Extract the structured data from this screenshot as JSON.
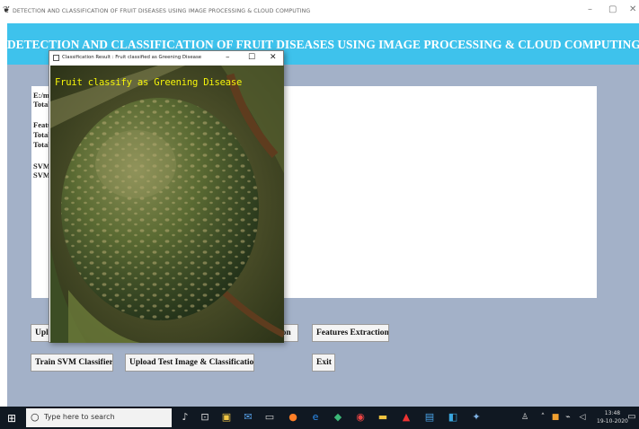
{
  "window": {
    "title": "DETECTION AND CLASSIFICATION OF FRUIT DISEASES USING IMAGE PROCESSING & CLOUD COMPUTING",
    "minimize": "–",
    "restore": "▢",
    "close": "✕"
  },
  "app": {
    "heading": "DETECTION AND CLASSIFICATION OF FRUIT DISEASES USING IMAGE PROCESSING & CLOUD COMPUTING",
    "output_lines": [
      "E:/m",
      "Total",
      "Featu",
      "Total",
      "Total",
      "SVM",
      "SVM"
    ],
    "buttons": {
      "upload": "Upl",
      "preprocess_suffix": "ion",
      "features": "Features Extraction",
      "train": "Train SVM Classifier",
      "upload_test": "Upload Test Image & Classification",
      "exit": "Exit"
    }
  },
  "popup": {
    "title": "Classification Result : Fruit classified as Greening Disease",
    "minimize": "–",
    "restore": "☐",
    "close": "✕",
    "overlay_text": "Fruit classify as Greening Disease"
  },
  "taskbar": {
    "search_placeholder": "Type here to search",
    "time": "13:48",
    "date": "19-10-2020"
  },
  "colors": {
    "header": "#3ec2ec",
    "app_bg": "#a3b1c8",
    "overlay_text": "#f5f50a",
    "taskbar": "#101822"
  }
}
